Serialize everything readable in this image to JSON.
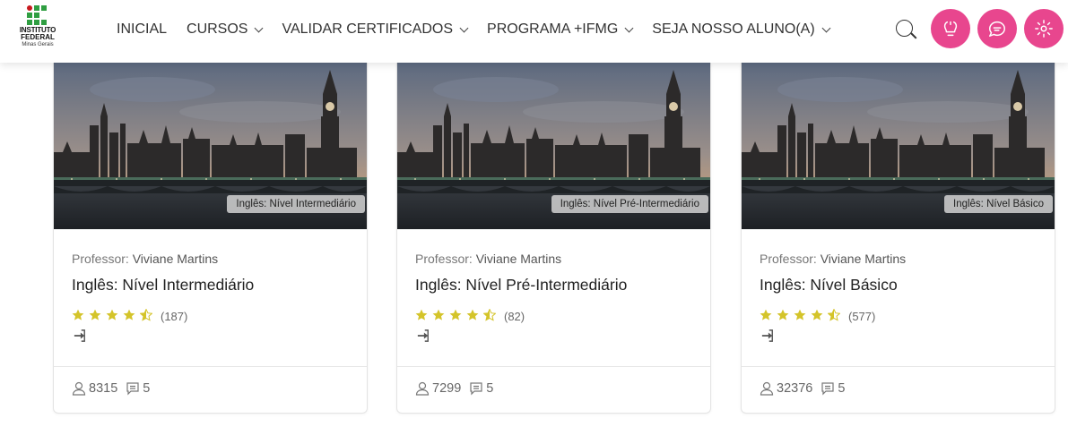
{
  "logo": {
    "line1": "INSTITUTO",
    "line2": "FEDERAL",
    "line3": "Minas Gerais"
  },
  "nav": {
    "items": [
      {
        "label": "INICIAL",
        "dropdown": false
      },
      {
        "label": "CURSOS",
        "dropdown": true
      },
      {
        "label": "VALIDAR CERTIFICADOS",
        "dropdown": true
      },
      {
        "label": "PROGRAMA +IFMG",
        "dropdown": true
      },
      {
        "label": "SEJA NOSSO ALUNO(A)",
        "dropdown": true
      }
    ]
  },
  "header_icons": [
    "search-icon",
    "accessibility-icon",
    "chat-icon",
    "settings-icon"
  ],
  "colors": {
    "accent": "#e8468e",
    "star": "#d4c42a",
    "logo_green": "#2f9e41",
    "logo_red": "#c8191e"
  },
  "cards": [
    {
      "tag": "Inglês: Nível Intermediário",
      "professor_label": "Professor:",
      "professor_name": "Viviane Martins",
      "title": "Inglês: Nível Intermediário",
      "rating": 4.5,
      "rating_count": "(187)",
      "students": "8315",
      "comments": "5"
    },
    {
      "tag": "Inglês: Nível Pré-Intermediário",
      "professor_label": "Professor:",
      "professor_name": "Viviane Martins",
      "title": "Inglês: Nível Pré-Intermediário",
      "rating": 4.5,
      "rating_count": "(82)",
      "students": "7299",
      "comments": "5"
    },
    {
      "tag": "Inglês: Nível Básico",
      "professor_label": "Professor:",
      "professor_name": "Viviane Martins",
      "title": "Inglês: Nível Básico",
      "rating": 4.5,
      "rating_count": "(577)",
      "students": "32376",
      "comments": "5"
    }
  ]
}
